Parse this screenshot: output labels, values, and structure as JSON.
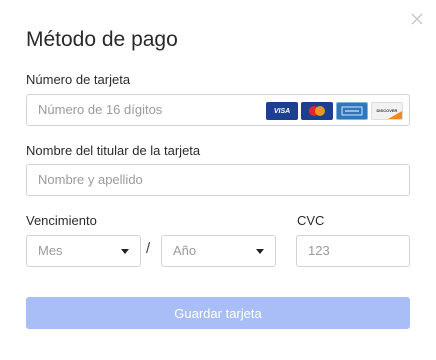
{
  "dialog": {
    "title": "Método de pago",
    "close_icon": "close-icon"
  },
  "card_number": {
    "label": "Número de tarjeta",
    "placeholder": "Número de 16 dígitos",
    "value": "",
    "brand_logos": [
      "VISA",
      "MasterCard",
      "American Express",
      "DISCOVER"
    ]
  },
  "cardholder": {
    "label": "Nombre del titular de la tarjeta",
    "placeholder": "Nombre y apellido",
    "value": ""
  },
  "expiry": {
    "label": "Vencimiento",
    "month_placeholder": "Mes",
    "separator": "/",
    "year_placeholder": "Año"
  },
  "cvc": {
    "label": "CVC",
    "placeholder": "123",
    "value": ""
  },
  "actions": {
    "save_label": "Guardar tarjeta",
    "save_color": "#a9bef7"
  }
}
